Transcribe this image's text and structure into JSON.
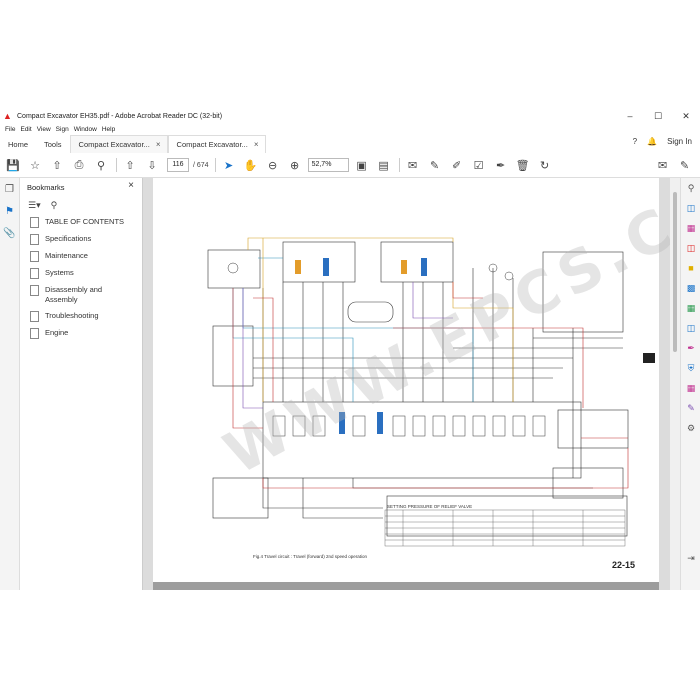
{
  "window": {
    "title": "Compact Excavator EH35.pdf - Adobe Acrobat Reader DC (32-bit)",
    "controls": [
      "–",
      "☐",
      "✕"
    ]
  },
  "menu": [
    "File",
    "Edit",
    "View",
    "Sign",
    "Window",
    "Help"
  ],
  "tabs": {
    "home": "Home",
    "tools": "Tools",
    "doc1": "Compact Excavator...",
    "doc2": "Compact Excavator...",
    "close": "×",
    "help": "?",
    "sign_in": "Sign In"
  },
  "toolbar": {
    "page_current": "116",
    "page_total": "/ 674",
    "zoom": "52,7%"
  },
  "bookmarks": {
    "title": "Bookmarks",
    "close": "×",
    "items": [
      {
        "label": "TABLE OF CONTENTS"
      },
      {
        "label": "Specifications"
      },
      {
        "label": "Maintenance"
      },
      {
        "label": "Systems"
      },
      {
        "label": "Disassembly and Assembly"
      },
      {
        "label": "Troubleshooting"
      },
      {
        "label": "Engine"
      }
    ]
  },
  "document": {
    "caption": "Fig.4 Travel circuit : Travel (forward) 2nd speed operation",
    "table_title": "SETTING PRESSURE OF RELIEF VALVE",
    "page_number": "22-15",
    "watermark": "WWW.EPCS.COM"
  },
  "colors": {
    "accent": "#1a73c9",
    "acrobat_red": "#d22222"
  }
}
